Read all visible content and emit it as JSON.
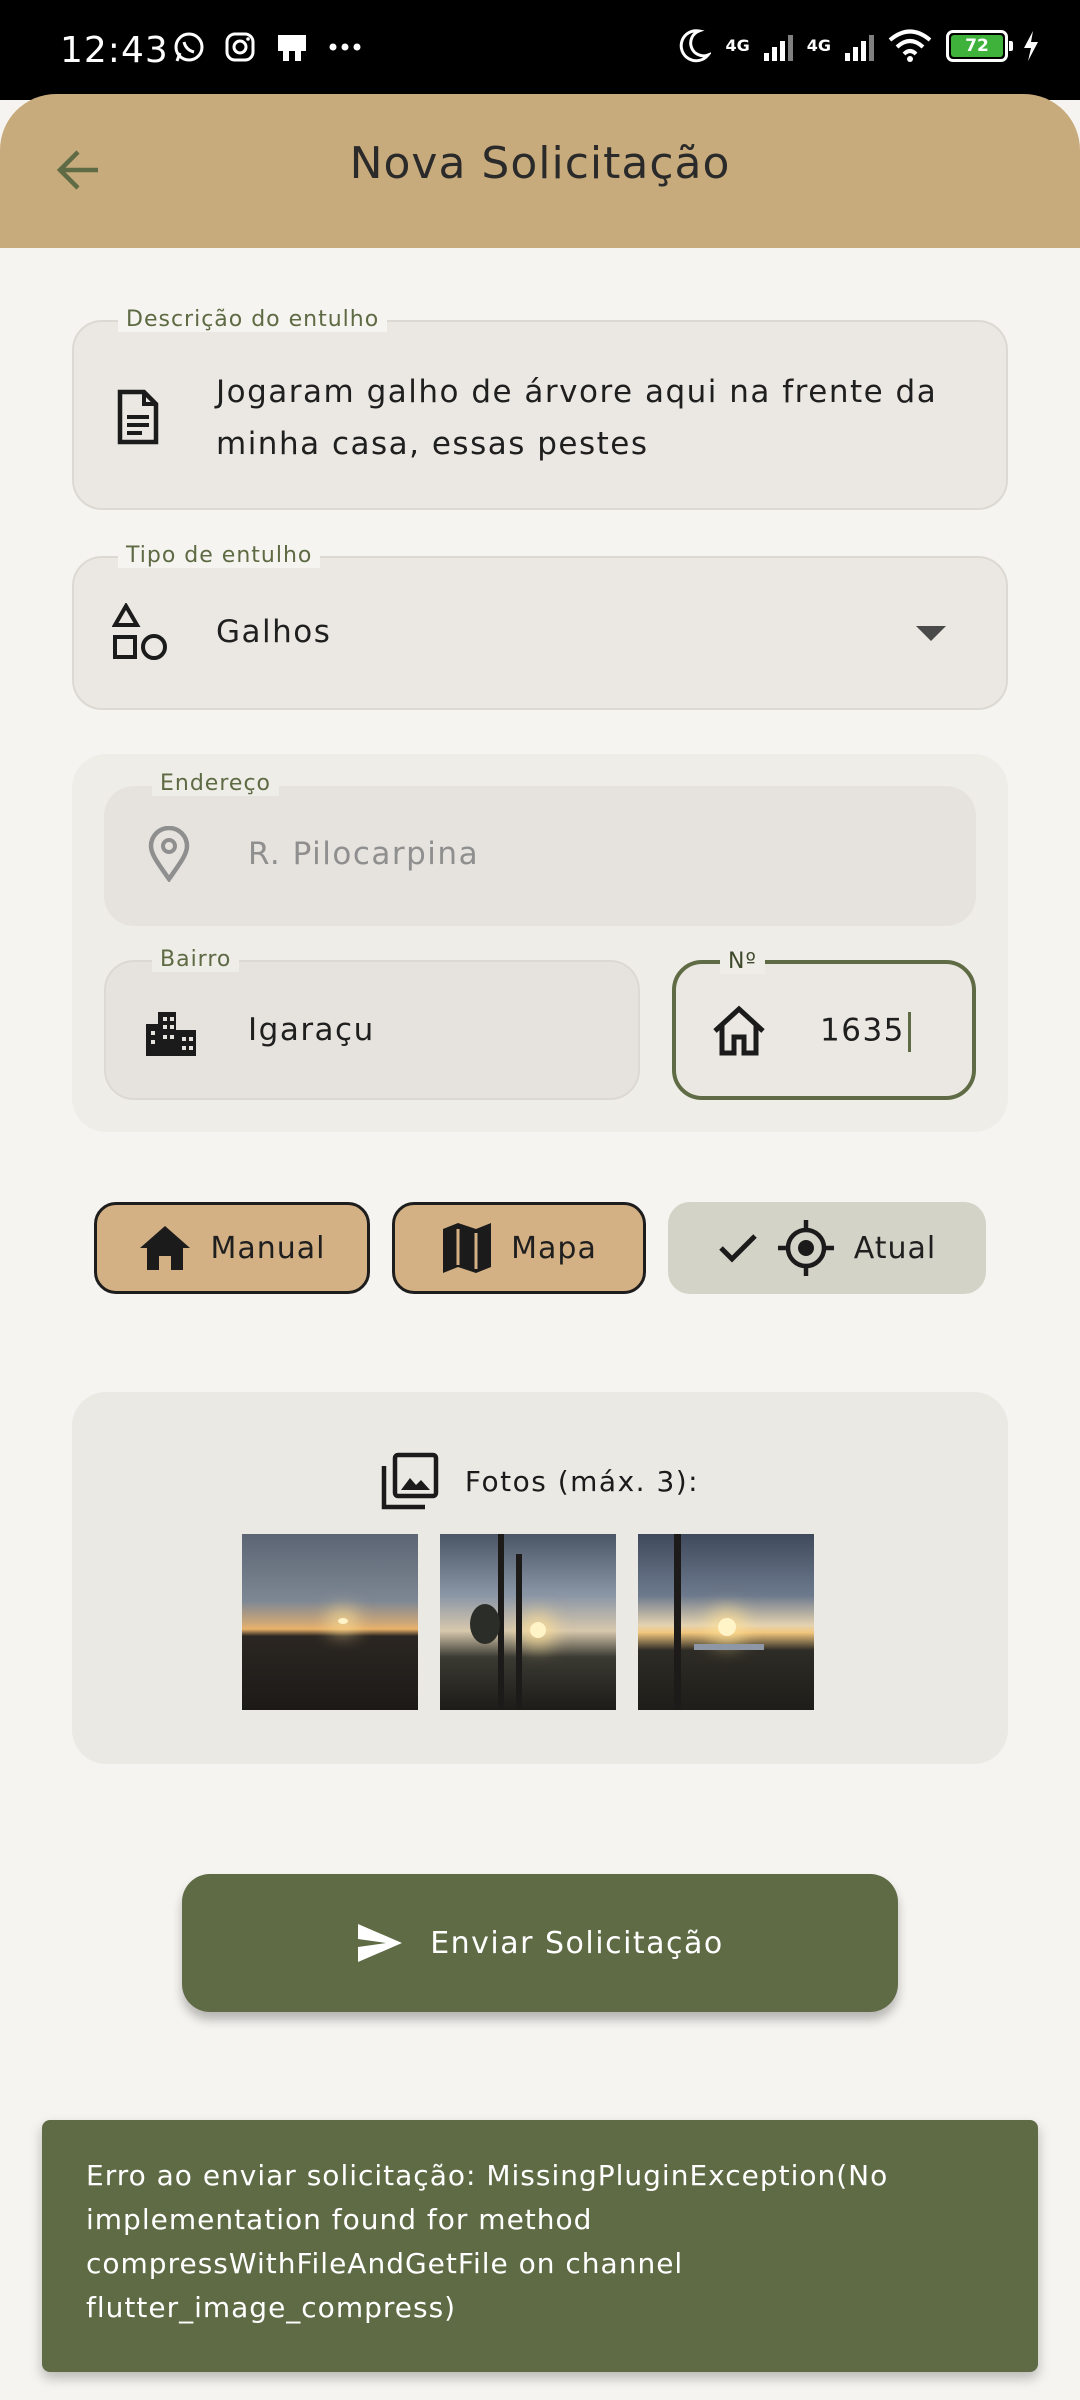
{
  "status_bar": {
    "time": "12:43",
    "icons": [
      "whatsapp-icon",
      "instagram-icon",
      "notification-icon",
      "more-dots"
    ],
    "network_1": "4G",
    "network_2": "4G",
    "battery": "72",
    "battery_color": "#3fb23b"
  },
  "appbar": {
    "title": "Nova Solicitação",
    "back_icon": "arrow-back-icon",
    "color": "#c8ab7c"
  },
  "form": {
    "description": {
      "label": "Descrição do entulho",
      "value": "Jogaram galho de árvore aqui na frente da minha casa, essas pestes",
      "icon": "document-icon"
    },
    "type": {
      "label": "Tipo de entulho",
      "value": "Galhos",
      "icon": "shapes-icon"
    },
    "address": {
      "label": "Endereço",
      "value": "R. Pilocarpina",
      "icon": "location-pin-icon"
    },
    "neighborhood": {
      "label": "Bairro",
      "value": "Igaraçu",
      "icon": "city-icon"
    },
    "number": {
      "label": "Nº",
      "value": "1635",
      "icon": "house-outline-icon"
    }
  },
  "location_buttons": {
    "manual": "Manual",
    "mapa": "Mapa",
    "atual": "Atual"
  },
  "photos": {
    "title": "Fotos (máx. 3):",
    "icon": "photo-library-icon",
    "count": 3
  },
  "submit": {
    "label": "Enviar Solicitação",
    "icon": "send-icon",
    "color": "#5f6b45"
  },
  "snackbar": {
    "message": "Erro ao enviar solicitação: MissingPluginException(No implementation found for method compressWithFileAndGetFile on channel flutter_image_compress)"
  }
}
